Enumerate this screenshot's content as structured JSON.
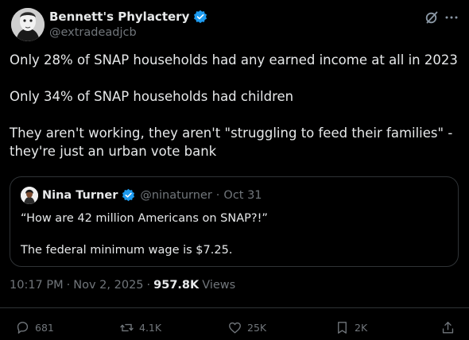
{
  "author": {
    "display_name": "Bennett's Phylactery",
    "handle": "@extradeadjcb",
    "verified": true
  },
  "tweet": {
    "lines": [
      "Only 28% of SNAP households had any earned income at all in 2023",
      "Only 34% of SNAP households had children",
      "They aren't working, they aren't \"struggling to feed their families\" -",
      "they're just an urban vote bank"
    ]
  },
  "quote": {
    "display_name": "Nina Turner",
    "handle": "@ninaturner",
    "separator": "·",
    "date": "Oct 31",
    "line1": "“How are 42 million Americans on SNAP?!”",
    "line2": "The federal minimum wage is $7.25."
  },
  "meta": {
    "time": "10:17 PM",
    "sep1": "·",
    "date": "Nov 2, 2025",
    "sep2": "·",
    "views_count": "957.8K",
    "views_label": "Views"
  },
  "actions": {
    "replies": "681",
    "reposts": "4.1K",
    "likes": "25K",
    "bookmarks": "2K"
  },
  "colors": {
    "background": "#000000",
    "text": "#e7e9ea",
    "muted": "#71767b",
    "verified": "#1d9bf0",
    "border": "#2f3336"
  },
  "icons": {
    "grok": "grok-icon",
    "more": "more-icon",
    "reply": "reply-icon",
    "repost": "repost-icon",
    "like": "heart-icon",
    "bookmark": "bookmark-icon",
    "share": "share-icon"
  }
}
